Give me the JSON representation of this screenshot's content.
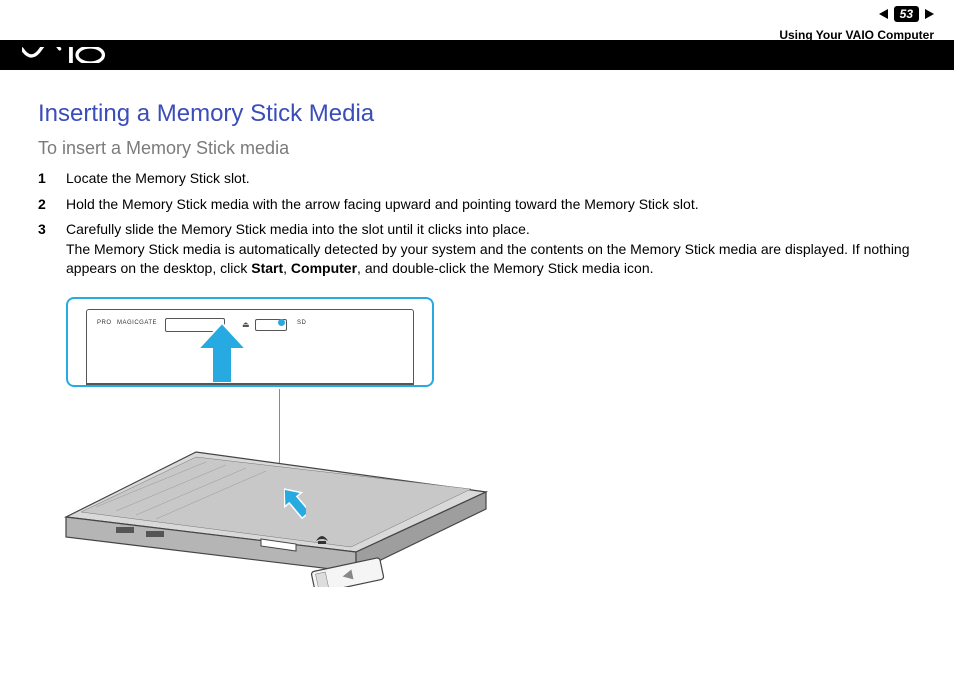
{
  "header": {
    "page_number": "53",
    "chapter": "Using Your VAIO Computer"
  },
  "content": {
    "title": "Inserting a Memory Stick Media",
    "subtitle": "To insert a Memory Stick media",
    "steps": [
      {
        "num": "1",
        "text": "Locate the Memory Stick slot."
      },
      {
        "num": "2",
        "text": "Hold the Memory Stick media with the arrow facing upward and pointing toward the Memory Stick slot."
      },
      {
        "num": "3",
        "text_pre": "Carefully slide the Memory Stick media into the slot until it clicks into place.\nThe Memory Stick media is automatically detected by your system and the contents on the Memory Stick media are displayed. If nothing appears on the desktop, click ",
        "bold1": "Start",
        "mid1": ", ",
        "bold2": "Computer",
        "text_post": ", and double-click the Memory Stick media icon."
      }
    ],
    "inset_labels": {
      "pro": "PRO",
      "magicgate": "MAGICGATE",
      "sd": "SD"
    }
  }
}
